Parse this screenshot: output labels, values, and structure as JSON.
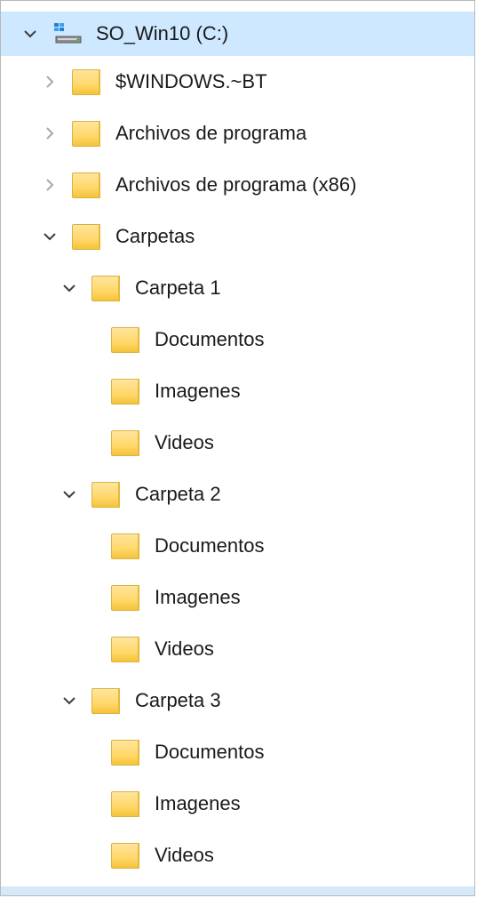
{
  "tree": {
    "items": [
      {
        "label": "SO_Win10 (C:)",
        "depth": 0,
        "expander": "expanded",
        "icon": "drive-icon",
        "selected": true
      },
      {
        "label": "$WINDOWS.~BT",
        "depth": 1,
        "expander": "collapsed",
        "icon": "folder-icon"
      },
      {
        "label": "Archivos de programa",
        "depth": 1,
        "expander": "collapsed",
        "icon": "folder-icon"
      },
      {
        "label": "Archivos de programa (x86)",
        "depth": 1,
        "expander": "collapsed",
        "icon": "folder-icon"
      },
      {
        "label": "Carpetas",
        "depth": 1,
        "expander": "expanded",
        "icon": "folder-icon"
      },
      {
        "label": "Carpeta 1",
        "depth": 2,
        "expander": "expanded",
        "icon": "folder-icon"
      },
      {
        "label": "Documentos",
        "depth": 3,
        "expander": "none",
        "icon": "folder-icon"
      },
      {
        "label": "Imagenes",
        "depth": 3,
        "expander": "none",
        "icon": "folder-icon"
      },
      {
        "label": "Videos",
        "depth": 3,
        "expander": "none",
        "icon": "folder-icon"
      },
      {
        "label": "Carpeta 2",
        "depth": 2,
        "expander": "expanded",
        "icon": "folder-icon"
      },
      {
        "label": "Documentos",
        "depth": 3,
        "expander": "none",
        "icon": "folder-icon"
      },
      {
        "label": "Imagenes",
        "depth": 3,
        "expander": "none",
        "icon": "folder-icon"
      },
      {
        "label": "Videos",
        "depth": 3,
        "expander": "none",
        "icon": "folder-icon"
      },
      {
        "label": "Carpeta 3",
        "depth": 2,
        "expander": "expanded",
        "icon": "folder-icon"
      },
      {
        "label": "Documentos",
        "depth": 3,
        "expander": "none",
        "icon": "folder-icon"
      },
      {
        "label": "Imagenes",
        "depth": 3,
        "expander": "none",
        "icon": "folder-icon"
      },
      {
        "label": "Videos",
        "depth": 3,
        "expander": "none",
        "icon": "folder-icon"
      }
    ]
  },
  "colors": {
    "selection": "#cde8ff",
    "folder": "#ffd86a",
    "chevron_expanded": "#3c3c3c",
    "chevron_collapsed": "#a8a8a8"
  }
}
